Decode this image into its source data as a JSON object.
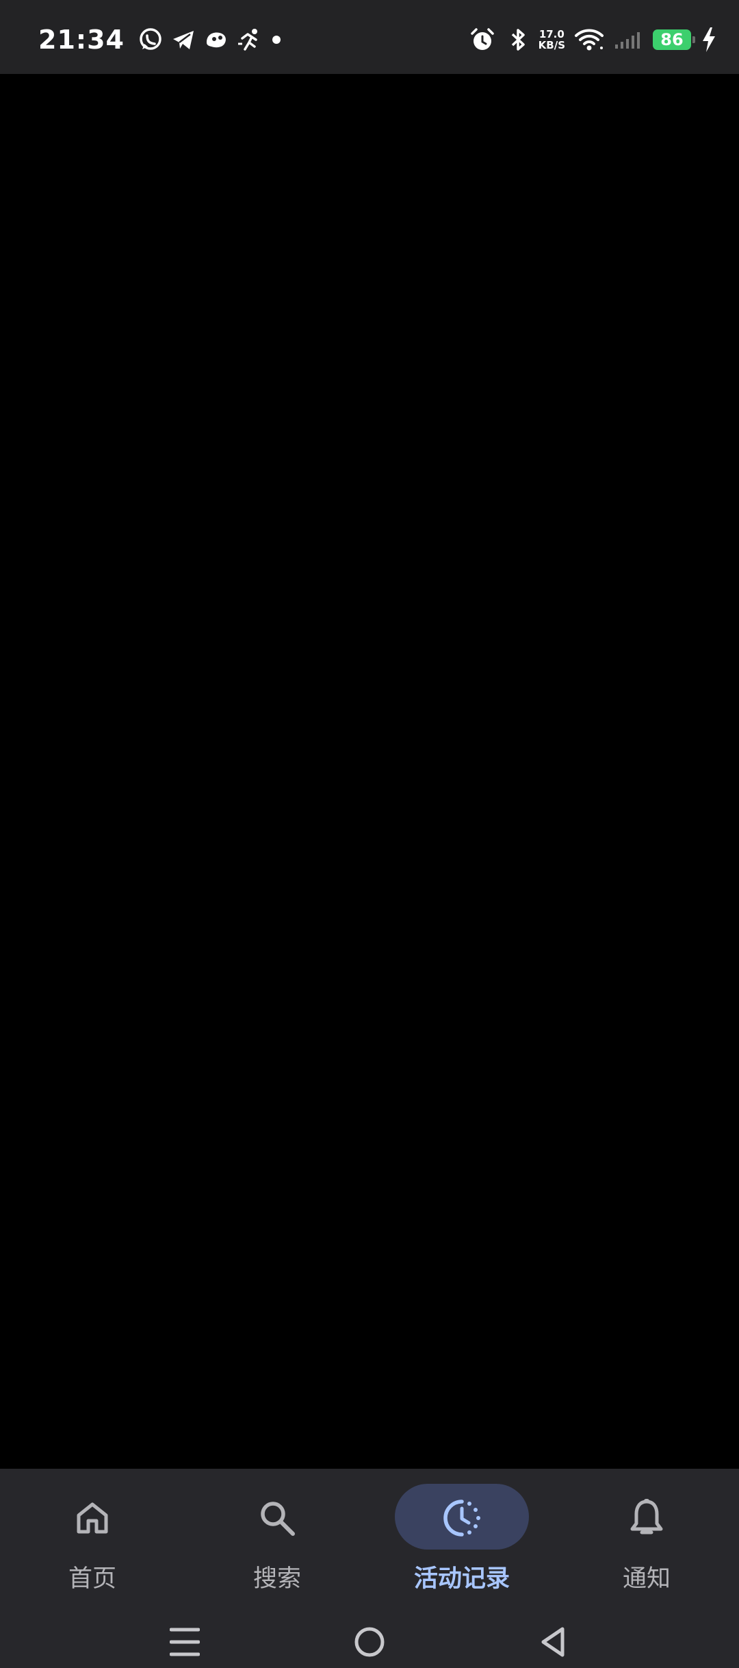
{
  "status_bar": {
    "time": "21:34",
    "notification_icons": [
      "whatsapp-icon",
      "telegram-icon",
      "game-icon",
      "activity-icon"
    ],
    "net_speed_value": "17.0",
    "net_speed_unit": "KB/S",
    "battery": "86"
  },
  "bottom_nav": {
    "items": [
      {
        "label": "首页",
        "icon": "home-icon",
        "active": false
      },
      {
        "label": "搜索",
        "icon": "search-icon",
        "active": false
      },
      {
        "label": "活动记录",
        "icon": "activity-clock-icon",
        "active": true
      },
      {
        "label": "通知",
        "icon": "bell-icon",
        "active": false
      }
    ],
    "active_color": "#a8c6ff",
    "pill_color": "#3a4260"
  },
  "system_nav": [
    "menu-icon",
    "home-circle-icon",
    "back-icon"
  ]
}
